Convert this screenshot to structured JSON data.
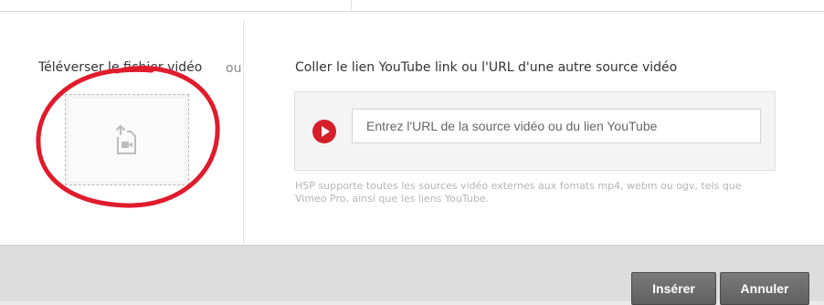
{
  "upload": {
    "title": "Téléverser le fichier vidéo",
    "icon": "upload-video-icon"
  },
  "or_label": "ou",
  "url_section": {
    "title": "Coller le lien YouTube link ou l'URL d'une autre source vidéo",
    "input_value": "",
    "input_placeholder": "Entrez l'URL de la source vidéo ou du lien YouTube",
    "icon": "play-icon",
    "help_text": "H5P supporte toutes les sources vidéo externes aux fomats mp4, webm ou ogv, tels que Vimeo Pro, ainsi que les liens YouTube."
  },
  "footer": {
    "insert_label": "Insérer",
    "cancel_label": "Annuler"
  },
  "colors": {
    "play_icon": "#d5202a",
    "annotation": "#e01c2c",
    "button": "#6b6b6b"
  }
}
